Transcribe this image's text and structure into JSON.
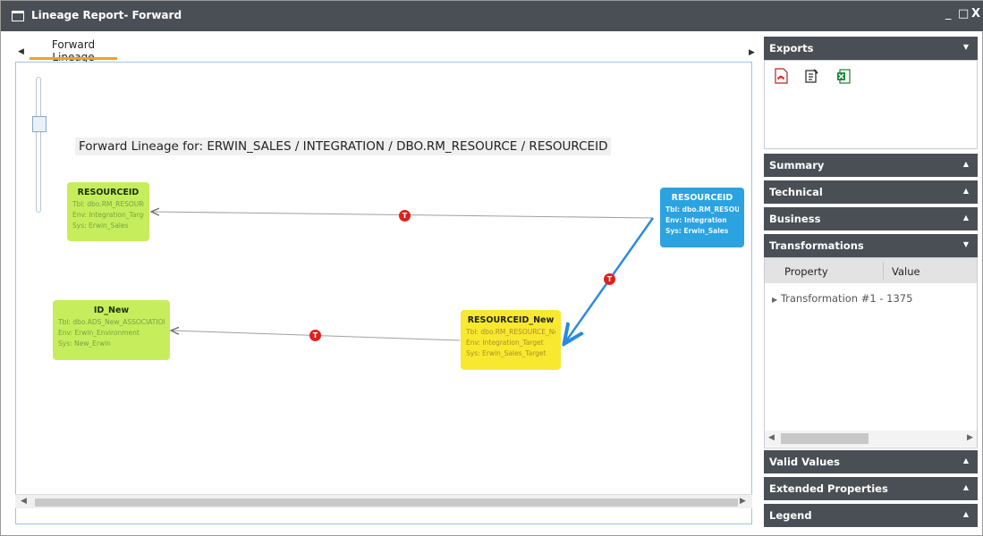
{
  "window": {
    "title": "Lineage Report- Forward",
    "minimize": "_",
    "maximize": "□",
    "close": "X"
  },
  "tabs": [
    {
      "label": "Forward Lineage",
      "active": true
    }
  ],
  "canvas": {
    "heading": "Forward Lineage for: ERWIN_SALES / INTEGRATION / DBO.RM_RESOURCE / RESOURCEID",
    "nodes": [
      {
        "name": "RESOURCEID",
        "tbl": "Tbl: dbo.RM_RESOURCE",
        "env": "Env: Integration_Target",
        "sys": "Sys: Erwin_Sales",
        "color": "green"
      },
      {
        "name": "ID_New",
        "tbl": "Tbl: dbo.ADS_New_ASSOCIATIONS",
        "env": "Env: Erwin_Environment",
        "sys": "Sys: New_Erwin",
        "color": "green"
      },
      {
        "name": "RESOURCEID",
        "tbl": "Tbl: dbo.RM_RESOURCE",
        "env": "Env: Integration",
        "sys": "Sys: Erwin_Sales",
        "color": "blue"
      },
      {
        "name": "RESOURCEID_New",
        "tbl": "Tbl: dbo.RM_RESOURCE_New",
        "env": "Env: Integration_Target",
        "sys": "Sys: Erwin_Sales_Target",
        "color": "yellow"
      }
    ],
    "transform_badge": "T"
  },
  "exports": {
    "title": "Exports",
    "icons": [
      "pdf-export-icon",
      "report-export-icon",
      "excel-export-icon"
    ]
  },
  "panels": {
    "summary": "Summary",
    "technical": "Technical",
    "business": "Business",
    "transformations": "Transformations",
    "valid_values": "Valid Values",
    "extended_properties": "Extended Properties",
    "legend": "Legend"
  },
  "transformations_grid": {
    "columns": [
      "Property",
      "Value"
    ],
    "rows": [
      "Transformation #1 - 1375"
    ]
  },
  "colors": {
    "titlebar": "#4a4f55",
    "accent": "#f0a030",
    "node_green": "#c6ee5c",
    "node_yellow": "#f8e830",
    "node_blue": "#2aa3e0",
    "badge_red": "#e0201c",
    "edge_blue": "#2a8ae0"
  }
}
